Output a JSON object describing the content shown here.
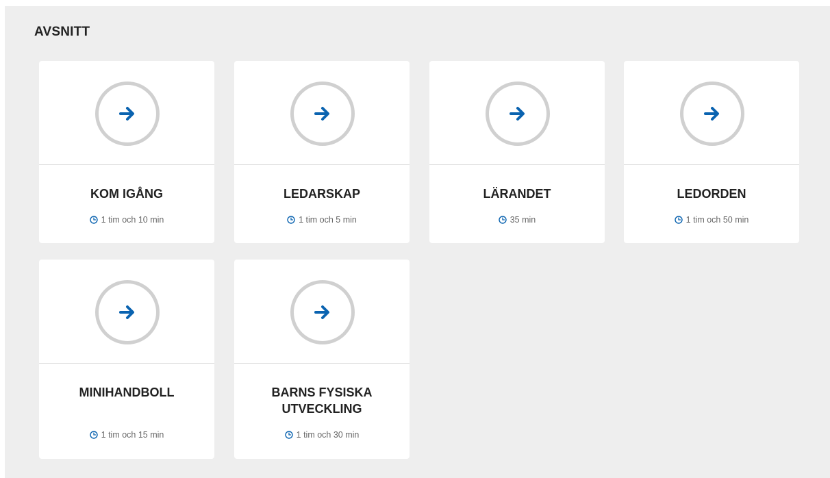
{
  "section": {
    "title": "AVSNITT"
  },
  "colors": {
    "accent": "#0a63b0",
    "ring": "#d0d0d0",
    "background": "#eeeeee"
  },
  "icons": {
    "card_icon": "arrow-right-icon",
    "duration_icon": "clock-icon"
  },
  "cards": [
    {
      "title": "KOM IGÅNG",
      "duration": "1 tim och 10 min"
    },
    {
      "title": "LEDARSKAP",
      "duration": "1 tim och 5 min"
    },
    {
      "title": "LÄRANDET",
      "duration": "35 min"
    },
    {
      "title": "LEDORDEN",
      "duration": "1 tim och 50 min"
    },
    {
      "title": "MINIHANDBOLL",
      "duration": "1 tim och 15 min"
    },
    {
      "title": "BARNS FYSISKA UTVECKLING",
      "duration": "1 tim och 30 min"
    }
  ]
}
